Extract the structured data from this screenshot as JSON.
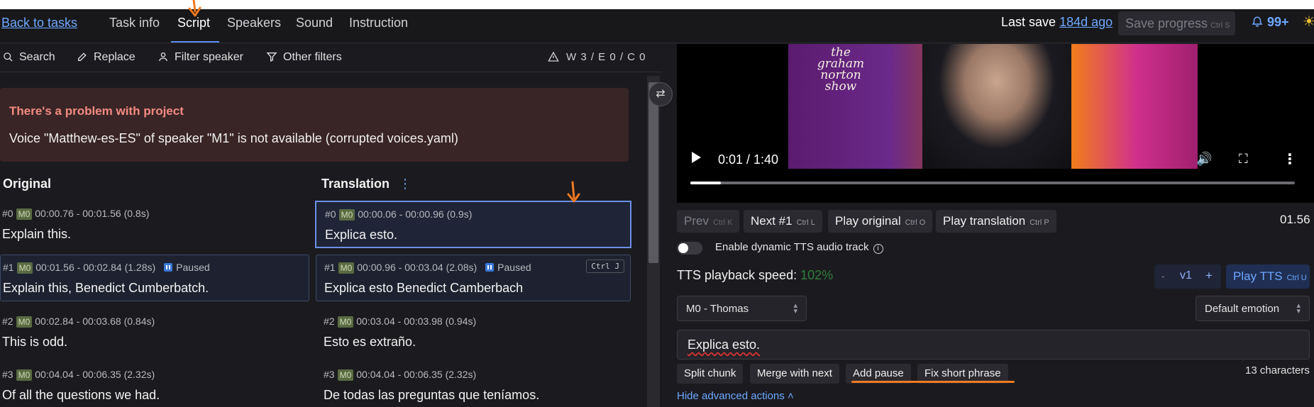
{
  "header": {
    "back_link": "Back to tasks",
    "tabs": [
      "Task info",
      "Script",
      "Speakers",
      "Sound",
      "Instruction"
    ],
    "active_tab": "Script",
    "last_save_label": "Last save",
    "last_save_value": "184d ago",
    "save_button": "Save progress",
    "save_kbd": "Ctrl S",
    "notifications": "99+"
  },
  "toolbar": {
    "search": "Search",
    "replace": "Replace",
    "filter_speaker": "Filter speaker",
    "other_filters": "Other filters",
    "warnings": "W 3 / E 0 / C 0"
  },
  "alert": {
    "title": "There's a problem with project",
    "message": "Voice \"Matthew-es-ES\" of speaker \"M1\" is not available (corrupted voices.yaml)"
  },
  "columns": {
    "original": "Original",
    "translation": "Translation"
  },
  "original_rows": [
    {
      "idx": "#0",
      "speaker": "M0",
      "time": "00:00.76 - 00:01.56 (0.8s)",
      "paused": "",
      "text": "Explain this."
    },
    {
      "idx": "#1",
      "speaker": "M0",
      "time": "00:01.56 - 00:02.84 (1.28s)",
      "paused": "Paused",
      "text": "Explain this, Benedict Cumberbatch."
    },
    {
      "idx": "#2",
      "speaker": "M0",
      "time": "00:02.84 - 00:03.68 (0.84s)",
      "paused": "",
      "text": "This is odd."
    },
    {
      "idx": "#3",
      "speaker": "M0",
      "time": "00:04.04 - 00:06.35 (2.32s)",
      "paused": "",
      "text": "Of all the questions we had."
    }
  ],
  "translation_rows": [
    {
      "idx": "#0",
      "speaker": "M0",
      "time": "00:00.06 - 00:00.96 (0.9s)",
      "paused": "",
      "text": "Explica esto."
    },
    {
      "idx": "#1",
      "speaker": "M0",
      "time": "00:00.96 - 00:03.04 (2.08s)",
      "paused": "Paused",
      "text": "Explica esto Benedict Camberbach",
      "kbd": "Ctrl J"
    },
    {
      "idx": "#2",
      "speaker": "M0",
      "time": "00:03.04 - 00:03.98 (0.94s)",
      "paused": "",
      "text": "Esto es extraño."
    },
    {
      "idx": "#3",
      "speaker": "M0",
      "time": "00:04.04 - 00:06.35 (2.32s)",
      "paused": "",
      "text": "De todas las preguntas que teníamos."
    }
  ],
  "video": {
    "time": "0:01 / 1:40",
    "progress": 0.05,
    "logo_text": "the graham norton show"
  },
  "controls": {
    "prev": "Prev",
    "prev_kbd": "Ctrl K",
    "next": "Next #1",
    "next_kbd": "Ctrl L",
    "play_original": "Play original",
    "play_original_kbd": "Ctrl O",
    "play_translation": "Play translation",
    "play_translation_kbd": "Ctrl P",
    "timecode": "01.56",
    "dynamic_tts_label": "Enable dynamic TTS audio track",
    "dynamic_tts_enabled": false,
    "speed_label": "TTS playback speed:",
    "speed_value": "102%",
    "step_minus": "-",
    "step_value": "v1",
    "step_plus": "+",
    "play_tts": "Play TTS",
    "play_tts_kbd": "Ctrl U",
    "speaker_select": "M0 - Thomas",
    "emotion_select": "Default emotion",
    "text_value": "Explica esto.",
    "actions": [
      "Split chunk",
      "Merge with next",
      "Add pause",
      "Fix short phrase"
    ],
    "char_count": "13 characters",
    "hide_advanced": "Hide advanced actions"
  },
  "colors": {
    "accent": "#6ea8ff",
    "annotation": "#f07a20",
    "alert_bg": "#3a2526",
    "alert_title": "#f28b82"
  }
}
